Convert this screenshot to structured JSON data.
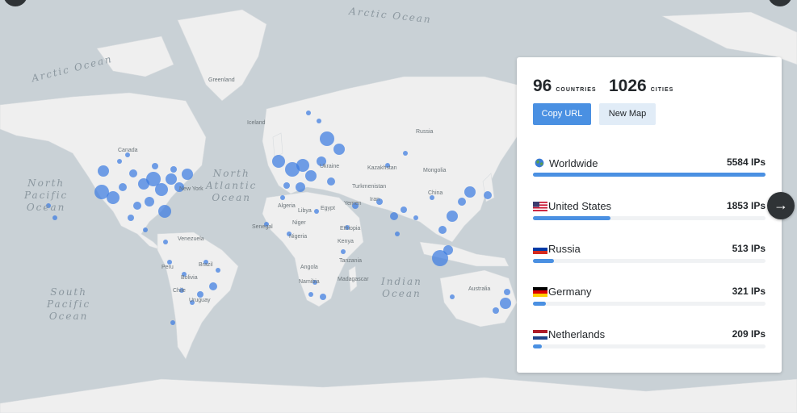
{
  "map": {
    "ocean_labels": [
      {
        "id": "arctic-ocean-top",
        "text": "Arctic Ocean"
      },
      {
        "id": "arctic-ocean-left",
        "text": "Arctic Ocean"
      },
      {
        "id": "north-pacific",
        "text": "North\nPacific\nOcean"
      },
      {
        "id": "north-atlantic",
        "text": "North\nAtlantic\nOcean"
      },
      {
        "id": "south-pacific",
        "text": "South\nPacific\nOcean"
      },
      {
        "id": "indian-ocean",
        "text": "Indian\nOcean"
      }
    ],
    "place_labels": [
      "Greenland",
      "Canada",
      "Russia",
      "Kazakhstan",
      "Mongolia",
      "China",
      "Iceland",
      "Algeria",
      "Egypt",
      "Turkmenistan",
      "Libya",
      "Niger",
      "Yemen",
      "Kenya",
      "Angola",
      "Namibia",
      "Madagascar",
      "Brazil",
      "Peru",
      "Bolivia",
      "Chile",
      "Venezuela",
      "Uruguay",
      "Australia",
      "New York",
      "Senegal",
      "Iran",
      "Nigeria",
      "Ukraine",
      "Ethiopia",
      "Tanzania"
    ]
  },
  "panel": {
    "countries_count": "96",
    "countries_label": "COUNTRIES",
    "cities_count": "1026",
    "cities_label": "CITIES",
    "copy_url_label": "Copy URL",
    "new_map_label": "New Map",
    "rows": [
      {
        "label": "Worldwide",
        "count": "5584 IPs",
        "fraction": 1.0,
        "icon": "globe-icon"
      },
      {
        "label": "United States",
        "count": "1853 IPs",
        "fraction": 0.332,
        "icon": "us-flag-icon"
      },
      {
        "label": "Russia",
        "count": "513 IPs",
        "fraction": 0.092,
        "icon": "russia-flag-icon"
      },
      {
        "label": "Germany",
        "count": "321 IPs",
        "fraction": 0.057,
        "icon": "germany-flag-icon"
      },
      {
        "label": "Netherlands",
        "count": "209 IPs",
        "fraction": 0.037,
        "icon": "netherlands-flag-icon"
      }
    ]
  },
  "colors": {
    "ocean": "#c9d1d6",
    "land": "#efefef",
    "marker": "#3b7be0",
    "accent": "#4a90e2"
  }
}
